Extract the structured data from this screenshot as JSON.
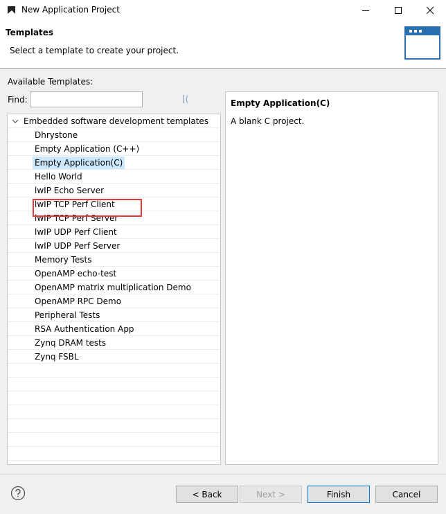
{
  "window": {
    "title": "New Application Project"
  },
  "header": {
    "title": "Templates",
    "description": "Select a template to create your project."
  },
  "templates": {
    "available_label": "Available Templates:",
    "find_label": "Find:",
    "find_value": "",
    "clear_glyph": "[(",
    "category": "Embedded software development templates",
    "items": [
      {
        "label": "Dhrystone"
      },
      {
        "label": "Empty Application (C++)"
      },
      {
        "label": "Empty Application(C)",
        "selected": true
      },
      {
        "label": "Hello World"
      },
      {
        "label": "lwIP Echo Server"
      },
      {
        "label": "lwIP TCP Perf Client"
      },
      {
        "label": "lwIP TCP Perf Server"
      },
      {
        "label": "lwIP UDP Perf Client"
      },
      {
        "label": "lwIP UDP Perf Server"
      },
      {
        "label": "Memory Tests"
      },
      {
        "label": "OpenAMP echo-test"
      },
      {
        "label": "OpenAMP matrix multiplication Demo"
      },
      {
        "label": "OpenAMP RPC Demo"
      },
      {
        "label": "Peripheral Tests"
      },
      {
        "label": "RSA Authentication App"
      },
      {
        "label": "Zynq DRAM tests"
      },
      {
        "label": "Zynq FSBL"
      }
    ]
  },
  "description": {
    "title": "Empty Application(C)",
    "body": "A blank C project."
  },
  "footer": {
    "back": "< Back",
    "next": "Next >",
    "finish": "Finish",
    "cancel": "Cancel"
  },
  "colors": {
    "selection": "#cce8ff",
    "highlight_border": "#e23a3a",
    "default_button_border": "#0078d7"
  }
}
